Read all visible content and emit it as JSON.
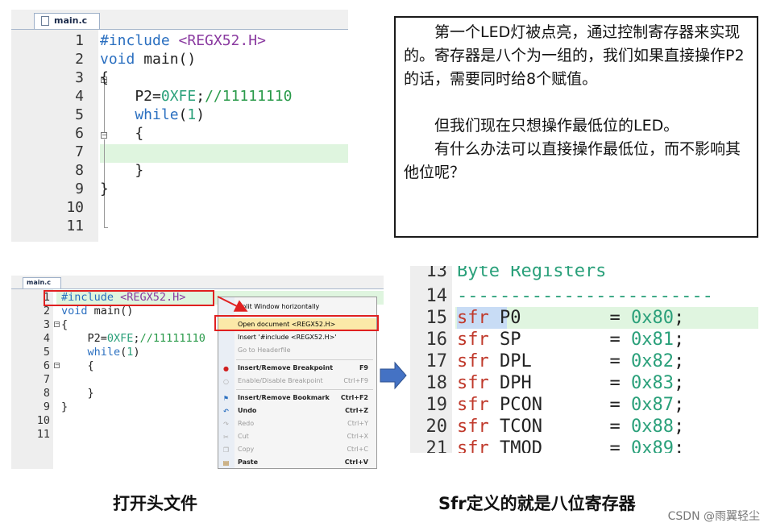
{
  "top_editor": {
    "tab_label": "main.c",
    "lines": [
      {
        "n": "1"
      },
      {
        "n": "2"
      },
      {
        "n": "3"
      },
      {
        "n": "4"
      },
      {
        "n": "5"
      },
      {
        "n": "6"
      },
      {
        "n": "7"
      },
      {
        "n": "8"
      },
      {
        "n": "9"
      },
      {
        "n": "10"
      },
      {
        "n": "11"
      }
    ],
    "code": {
      "l1_pp": "#include",
      "l1_str": " <REGX52.H>",
      "l2_kw": "void",
      "l2_rest": " main()",
      "l3": "{",
      "l4_a": "    P2=",
      "l4_num": "0XFE",
      "l4_b": ";",
      "l4_cm": "//11111110",
      "l5_kw": "    while",
      "l5_a": "(",
      "l5_num": "1",
      "l5_b": ")",
      "l6": "    {",
      "l8": "    }",
      "l9": "}"
    }
  },
  "text_box": {
    "p1": "第一个LED灯被点亮，通过控制寄存器来实现的。寄存器是八个为一组的，我们如果直接操作P2的话，需要同时给8个赋值。",
    "p2": "但我们现在只想操作最低位的LED。",
    "p3": "有什么办法可以直接操作最低位，而不影响其他位呢？"
  },
  "bl_editor": {
    "tab_label": "main.c",
    "lines": [
      "1",
      "2",
      "3",
      "4",
      "5",
      "6",
      "7",
      "8",
      "9",
      "10",
      "11"
    ],
    "code": {
      "l1_pp": "#include",
      "l1_str": " <REGX52.H>",
      "l2_kw": "void",
      "l2_rest": " main()",
      "l3": "{",
      "l4_a": "    P2=",
      "l4_num": "0XFE",
      "l4_b": ";",
      "l4_cm": "//11111110",
      "l5_kw": "    while",
      "l5_a": "(",
      "l5_num": "1",
      "l5_b": ")",
      "l6": "    {",
      "l8": "    }",
      "l9": "}"
    }
  },
  "context_menu": {
    "items": [
      {
        "label": "Split Window horizontally",
        "shortcut": "",
        "state": "enabled"
      },
      {
        "label": "Open document <REGX52.H>",
        "shortcut": "",
        "state": "selected"
      },
      {
        "label": "Insert '#include <REGX52.H>'",
        "shortcut": "",
        "state": "enabled"
      },
      {
        "label": "Go to Headerfile",
        "shortcut": "",
        "state": "disabled"
      },
      {
        "label": "Insert/Remove Breakpoint",
        "shortcut": "F9",
        "state": "bold"
      },
      {
        "label": "Enable/Disable Breakpoint",
        "shortcut": "Ctrl+F9",
        "state": "disabled"
      },
      {
        "label": "Insert/Remove Bookmark",
        "shortcut": "Ctrl+F2",
        "state": "bold"
      },
      {
        "label": "Undo",
        "shortcut": "Ctrl+Z",
        "state": "bold"
      },
      {
        "label": "Redo",
        "shortcut": "Ctrl+Y",
        "state": "disabled"
      },
      {
        "label": "Cut",
        "shortcut": "Ctrl+X",
        "state": "disabled"
      },
      {
        "label": "Copy",
        "shortcut": "Ctrl+C",
        "state": "disabled"
      },
      {
        "label": "Paste",
        "shortcut": "Ctrl+V",
        "state": "bold"
      }
    ]
  },
  "br_editor": {
    "header_partial": "Byte Registers",
    "rows": [
      {
        "n": "13",
        "kind": "header"
      },
      {
        "n": "14",
        "kind": "dashes",
        "text": "------------------------"
      },
      {
        "n": "15",
        "sfr": "sfr",
        "name": "P0",
        "eq": "=",
        "val": "0x80",
        "semi": ";"
      },
      {
        "n": "16",
        "sfr": "sfr",
        "name": "SP",
        "eq": "=",
        "val": "0x81",
        "semi": ";"
      },
      {
        "n": "17",
        "sfr": "sfr",
        "name": "DPL",
        "eq": "=",
        "val": "0x82",
        "semi": ";"
      },
      {
        "n": "18",
        "sfr": "sfr",
        "name": "DPH",
        "eq": "=",
        "val": "0x83",
        "semi": ";"
      },
      {
        "n": "19",
        "sfr": "sfr",
        "name": "PCON",
        "eq": "=",
        "val": "0x87",
        "semi": ";"
      },
      {
        "n": "20",
        "sfr": "sfr",
        "name": "TCON",
        "eq": "=",
        "val": "0x88",
        "semi": ";"
      },
      {
        "n": "21",
        "sfr": "sfr",
        "name": "TMOD",
        "eq": "=",
        "val": "0x89",
        "semi": ";"
      }
    ]
  },
  "captions": {
    "left": "打开头文件",
    "right": "Sfr定义的就是八位寄存器"
  },
  "watermark": "CSDN @雨翼轻尘",
  "colors": {
    "keyword": "#2a6fc0",
    "string": "#8a3aa0",
    "number": "#2aa07a",
    "comment": "#2a9a4a",
    "sfr": "#c0392b",
    "highlight": "#dff5df",
    "arrow_red": "#e02020",
    "arrow_blue": "#4472c4"
  }
}
